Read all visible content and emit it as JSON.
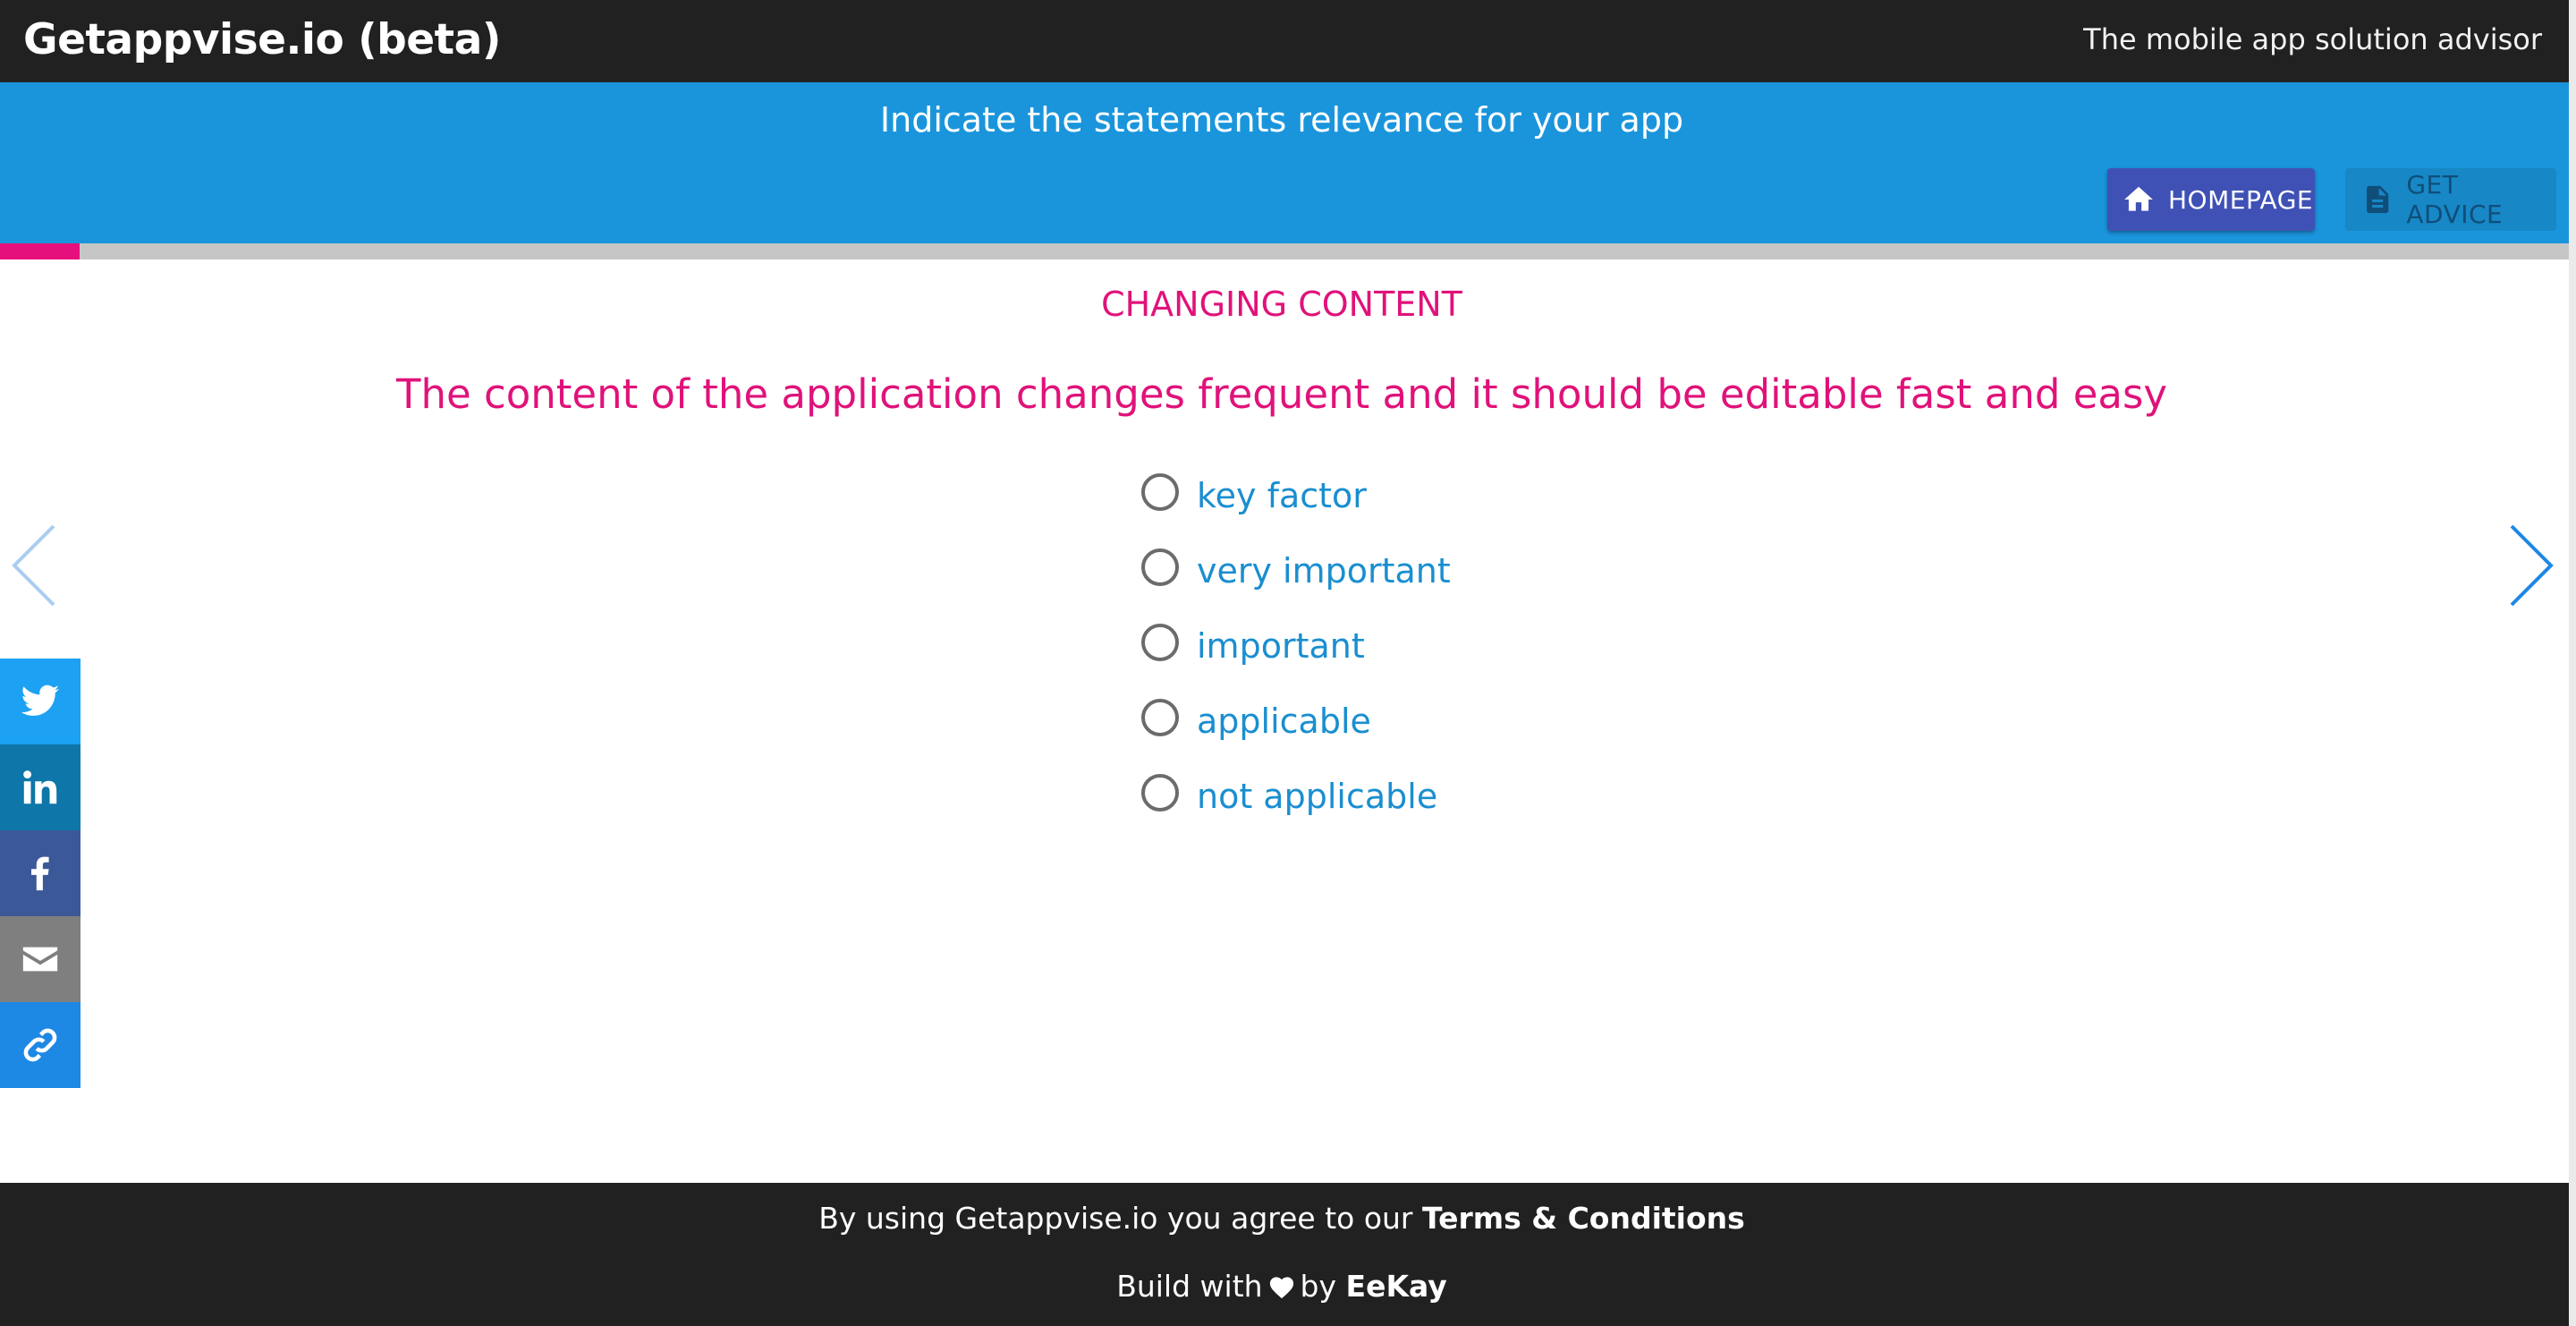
{
  "header": {
    "app_title": "Getappvise.io (beta)",
    "tagline": "The mobile app solution advisor"
  },
  "banner": {
    "title": "Indicate the statements relevance for your app",
    "homepage_label": "HOMEPAGE",
    "get_advice_label": "GET ADVICE"
  },
  "progress": {
    "value_fraction": 0.031
  },
  "question": {
    "category": "CHANGING CONTENT",
    "statement": "The content of the application changes frequent and it should be editable fast and easy",
    "options": [
      {
        "label": "key factor",
        "selected": false
      },
      {
        "label": "very important",
        "selected": false
      },
      {
        "label": "important",
        "selected": false
      },
      {
        "label": "applicable",
        "selected": false
      },
      {
        "label": "not applicable",
        "selected": false
      }
    ]
  },
  "share": [
    {
      "icon": "twitter-icon",
      "color": "#1da1f2"
    },
    {
      "icon": "linkedin-icon",
      "color": "#0e76a8"
    },
    {
      "icon": "facebook-icon",
      "color": "#3b5998"
    },
    {
      "icon": "email-icon",
      "color": "#7f7f7f"
    },
    {
      "icon": "link-icon",
      "color": "#1e88e5"
    }
  ],
  "footer": {
    "line1_prefix": "By using Getappvise.io you agree to our",
    "terms_link": "Terms & Conditions",
    "line2_prefix": "Build with",
    "line2_by": "by",
    "author": "EeKay"
  },
  "colors": {
    "topbar": "#212121",
    "banner": "#1a95dc",
    "accent_pink": "#e0127a",
    "option_blue": "#1a8ed0",
    "home_button": "#3f51b5"
  }
}
